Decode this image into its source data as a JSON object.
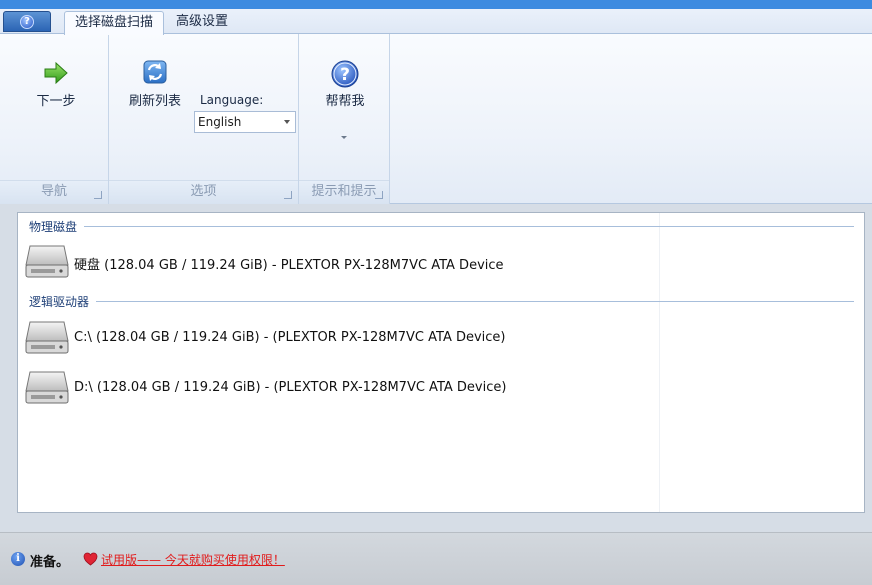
{
  "app_menu": {
    "icon": "help-circle-icon"
  },
  "tabs": [
    {
      "label": "选择磁盘扫描"
    },
    {
      "label": "高级设置"
    }
  ],
  "ribbon": {
    "groups": [
      {
        "label": "导航",
        "buttons": [
          {
            "label": "下一步",
            "icon": "green-arrow-right-icon"
          }
        ]
      },
      {
        "label": "选项",
        "buttons": [
          {
            "label": "刷新列表",
            "icon": "refresh-icon"
          }
        ],
        "language": {
          "label": "Language:",
          "selected": "English"
        }
      },
      {
        "label": "提示和提示",
        "buttons": [
          {
            "label": "帮帮我",
            "icon": "help-icon"
          }
        ]
      }
    ]
  },
  "disks": {
    "physical": {
      "title": "物理磁盘",
      "items": [
        {
          "text": "硬盘 (128.04 GB / 119.24 GiB) - PLEXTOR PX-128M7VC ATA Device"
        }
      ]
    },
    "logical": {
      "title": "逻辑驱动器",
      "items": [
        {
          "text": "C:\\ (128.04 GB / 119.24 GiB) -  (PLEXTOR PX-128M7VC ATA Device)"
        },
        {
          "text": "D:\\ (128.04 GB / 119.24 GiB) -  (PLEXTOR PX-128M7VC ATA Device)"
        }
      ]
    }
  },
  "status": {
    "text": "准备。",
    "trial_text": "试用版—— 今天就购买使用权限！",
    "colors": {
      "trial": "#e11b1b",
      "accent": "#3d8be0"
    }
  }
}
